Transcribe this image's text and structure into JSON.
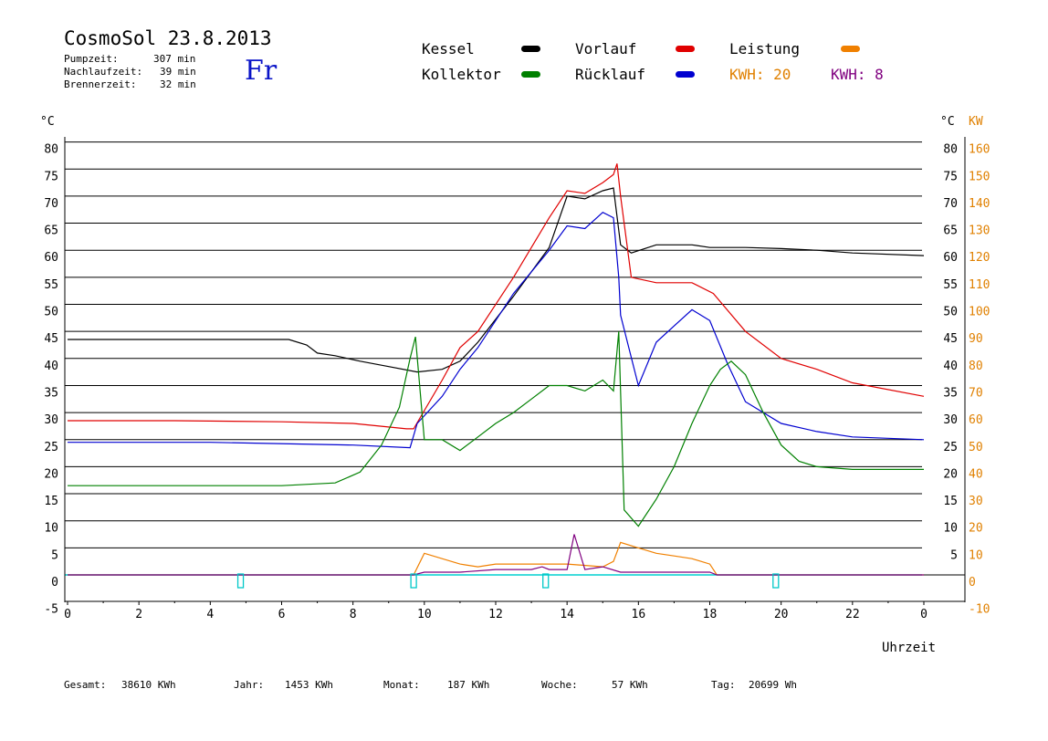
{
  "header": {
    "title": "CosmoSol 23.8.2013",
    "weekday": "Fr",
    "stats": [
      {
        "label": "Pumpzeit:",
        "value": "307 min"
      },
      {
        "label": "Nachlaufzeit:",
        "value": "39 min"
      },
      {
        "label": "Brennerzeit:",
        "value": "32 min"
      }
    ]
  },
  "legend": {
    "kessel": {
      "label": "Kessel",
      "color": "#000000"
    },
    "vorlauf": {
      "label": "Vorlauf",
      "color": "#e00000"
    },
    "leistung": {
      "label": "Leistung",
      "color": "#f08000"
    },
    "kollektor": {
      "label": "Kollektor",
      "color": "#008000"
    },
    "ruecklauf": {
      "label": "Rücklauf",
      "color": "#0000d0"
    },
    "kwh1": {
      "label": "KWH: 20",
      "color": "#e08000"
    },
    "kwh2": {
      "label": "KWH: 8",
      "color": "#800080"
    }
  },
  "footer": [
    {
      "label": "Gesamt:",
      "value": "38610 KWh"
    },
    {
      "label": "Jahr:",
      "value": "1453 KWh"
    },
    {
      "label": "Monat:",
      "value": "187 KWh"
    },
    {
      "label": "Woche:",
      "value": "57 KWh"
    },
    {
      "label": "Tag:",
      "value": "20699 Wh"
    }
  ],
  "chart_data": {
    "type": "line",
    "xlabel": "Uhrzeit",
    "ylabel_left": "°C",
    "ylabel_right_temp": "°C",
    "ylabel_right_power": "KW",
    "xlim": [
      0,
      24
    ],
    "ylim": [
      -5,
      80
    ],
    "x_ticks": [
      0,
      2,
      4,
      6,
      8,
      10,
      12,
      14,
      16,
      18,
      20,
      22,
      24
    ],
    "x_tick_labels": [
      "0",
      "2",
      "4",
      "6",
      "8",
      "10",
      "12",
      "14",
      "16",
      "18",
      "20",
      "22",
      "0"
    ],
    "y_ticks_left": [
      -5,
      0,
      5,
      10,
      15,
      20,
      25,
      30,
      35,
      40,
      45,
      50,
      55,
      60,
      65,
      70,
      75,
      80
    ],
    "y_ticks_right_temp": [
      5,
      10,
      15,
      20,
      25,
      30,
      35,
      40,
      45,
      50,
      55,
      60,
      65,
      70,
      75,
      80
    ],
    "y_ticks_right_power": [
      -10,
      0,
      10,
      20,
      30,
      40,
      50,
      60,
      70,
      80,
      90,
      100,
      110,
      120,
      130,
      140,
      150,
      160
    ],
    "grid": true,
    "series": [
      {
        "name": "Kessel",
        "color": "#000000",
        "x": [
          0,
          3,
          6.2,
          6.7,
          7.0,
          7.5,
          8.2,
          9.0,
          9.8,
          10.5,
          11.0,
          11.5,
          12.5,
          13.5,
          14.0,
          14.5,
          15.0,
          15.3,
          15.5,
          15.8,
          16.5,
          17.5,
          18.0,
          19.0,
          20.0,
          21.0,
          22.0,
          24.0
        ],
        "y": [
          43.5,
          43.5,
          43.5,
          42.5,
          41,
          40.5,
          39.5,
          38.5,
          37.5,
          38,
          39.5,
          43,
          51.5,
          60.5,
          70,
          69.5,
          71,
          71.5,
          61,
          59.5,
          61,
          61,
          60.5,
          60.5,
          60.3,
          60,
          59.5,
          59
        ]
      },
      {
        "name": "Vorlauf",
        "color": "#e00000",
        "x": [
          0,
          3,
          6,
          8,
          9.5,
          9.7,
          10.5,
          11.0,
          11.5,
          12.5,
          13.5,
          14.0,
          14.5,
          15.0,
          15.3,
          15.4,
          15.5,
          15.8,
          16.5,
          17.5,
          18.1,
          19.0,
          20.0,
          21.0,
          22.0,
          24.0
        ],
        "y": [
          28.5,
          28.5,
          28.3,
          28,
          27,
          27,
          36,
          42,
          45,
          55,
          66,
          71,
          70.5,
          72.5,
          74,
          76,
          70,
          55,
          54,
          54,
          52,
          45,
          40,
          38,
          35.5,
          33
        ]
      },
      {
        "name": "Rücklauf",
        "color": "#0000d0",
        "x": [
          0,
          4,
          8,
          9.6,
          9.8,
          10.5,
          11.0,
          11.5,
          12.5,
          13.5,
          14.0,
          14.5,
          15.0,
          15.3,
          15.45,
          15.5,
          16.0,
          16.5,
          17.0,
          17.5,
          18.0,
          18.5,
          19.0,
          20.0,
          21.0,
          22.0,
          24.0
        ],
        "y": [
          24.5,
          24.5,
          24,
          23.5,
          28,
          33,
          38,
          42,
          52,
          60,
          64.5,
          64,
          67,
          66,
          55,
          48,
          35,
          43,
          46,
          49,
          47,
          39,
          32,
          28,
          26.5,
          25.5,
          25
        ]
      },
      {
        "name": "Kollektor",
        "color": "#008000",
        "x": [
          0,
          2,
          4,
          6,
          7.5,
          8.2,
          8.8,
          9.3,
          9.6,
          9.75,
          10.0,
          10.5,
          11.0,
          11.4,
          12.0,
          12.5,
          13.0,
          13.5,
          14.0,
          14.5,
          15.0,
          15.3,
          15.45,
          15.6,
          16.0,
          16.5,
          17.0,
          17.5,
          18.0,
          18.3,
          18.6,
          19.0,
          19.5,
          20.0,
          20.5,
          21.0,
          22.0,
          24.0
        ],
        "y": [
          16.5,
          16.5,
          16.5,
          16.5,
          17,
          19,
          24,
          31,
          40,
          44,
          25,
          25,
          23,
          25,
          28,
          30,
          32.5,
          35,
          35,
          34,
          36,
          34,
          45,
          12,
          9,
          14,
          20,
          28,
          35,
          38,
          39.5,
          37,
          30,
          24,
          21,
          20,
          19.5,
          19.5
        ]
      },
      {
        "name": "Leistung",
        "color": "#f08000",
        "axis": "KW",
        "x": [
          0,
          9.7,
          10.0,
          11.0,
          11.5,
          12.0,
          13.0,
          14.0,
          15.0,
          15.3,
          15.5,
          16.0,
          16.5,
          17.0,
          17.5,
          18.0,
          18.2,
          24.0
        ],
        "y": [
          0,
          0,
          8,
          4,
          3,
          4,
          4,
          4,
          3,
          5,
          12,
          10,
          8,
          7,
          6,
          4,
          0,
          0
        ]
      },
      {
        "name": "KWH: 8",
        "color": "#800080",
        "axis": "KW",
        "x": [
          0,
          9.7,
          10.0,
          11.0,
          12.0,
          13.0,
          13.3,
          13.5,
          14.0,
          14.2,
          14.5,
          15.0,
          15.5,
          16.0,
          18.0,
          18.2,
          24.0
        ],
        "y": [
          0,
          0,
          1,
          1,
          2,
          2,
          3,
          2,
          2,
          15,
          2,
          3,
          1,
          1,
          1,
          0,
          0
        ]
      }
    ],
    "markers_x": [
      4.85,
      9.7,
      13.4,
      19.85
    ]
  }
}
